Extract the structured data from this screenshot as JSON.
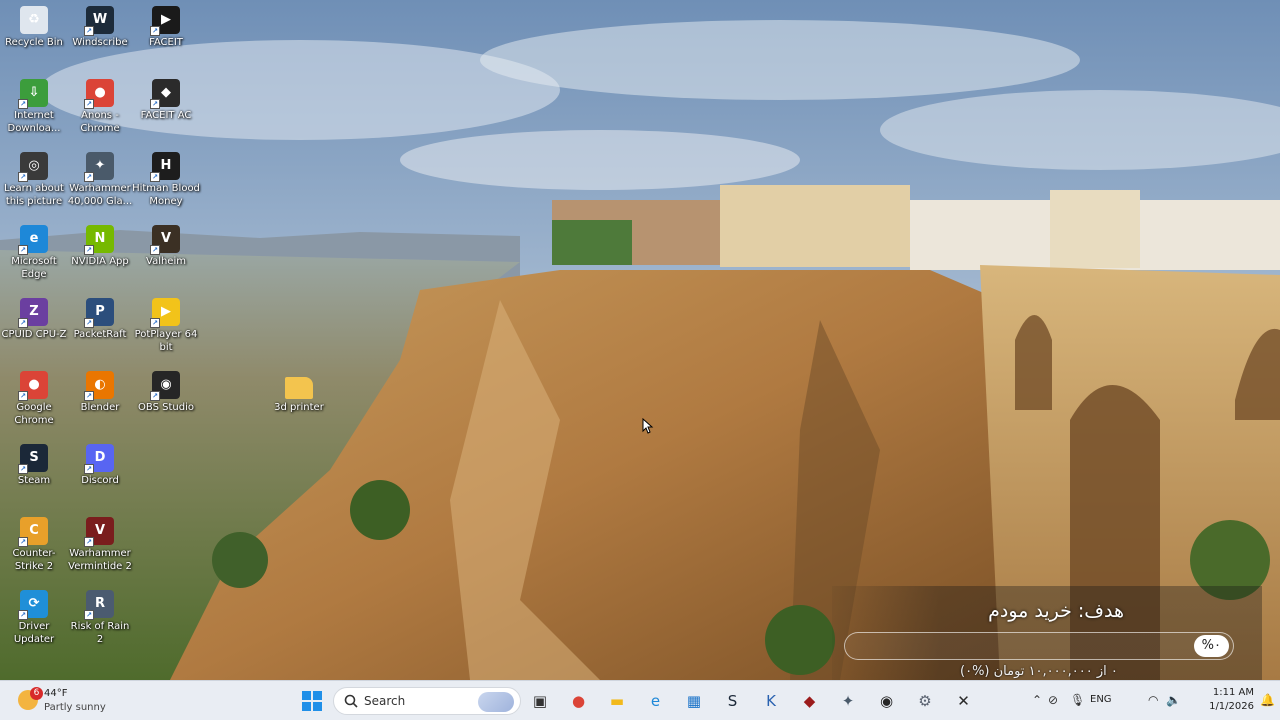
{
  "desktop": {
    "icons": [
      {
        "label": "Recycle Bin",
        "icon": "recycle-bin-icon",
        "color": "#dfe6ee",
        "glyph": "♻"
      },
      {
        "label": "Windscribe",
        "icon": "windscribe-icon",
        "color": "#1d2b3a",
        "glyph": "W"
      },
      {
        "label": "FACEIT",
        "icon": "faceit-icon",
        "color": "#1a1a1a",
        "glyph": "▶"
      },
      {
        "label": "Internet Downloa...",
        "icon": "idm-icon",
        "color": "#3c9d3c",
        "glyph": "⇩"
      },
      {
        "label": "Anons - Chrome",
        "icon": "chrome-icon",
        "color": "#db4437",
        "glyph": "●"
      },
      {
        "label": "FACEIT AC",
        "icon": "faceit-ac-icon",
        "color": "#2b2b2b",
        "glyph": "◆"
      },
      {
        "label": "Learn about this picture",
        "icon": "camera-icon",
        "color": "#3a3a3a",
        "glyph": "◎"
      },
      {
        "label": "Warhammer 40,000 Gla...",
        "icon": "warhammer-icon",
        "color": "#4a5a6a",
        "glyph": "✦"
      },
      {
        "label": "Hitman Blood Money",
        "icon": "hitman-icon",
        "color": "#1d1d1d",
        "glyph": "H"
      },
      {
        "label": "Microsoft Edge",
        "icon": "edge-icon",
        "color": "#1e88d8",
        "glyph": "e"
      },
      {
        "label": "NVIDIA App",
        "icon": "nvidia-icon",
        "color": "#76b900",
        "glyph": "N"
      },
      {
        "label": "Valheim",
        "icon": "valheim-icon",
        "color": "#3b3024",
        "glyph": "V"
      },
      {
        "label": "CPUID CPU-Z",
        "icon": "cpuz-icon",
        "color": "#6b3fa0",
        "glyph": "Z"
      },
      {
        "label": "PacketRaft",
        "icon": "packetraft-icon",
        "color": "#2c4e7c",
        "glyph": "P"
      },
      {
        "label": "PotPlayer 64 bit",
        "icon": "potplayer-icon",
        "color": "#f2c31a",
        "glyph": "▶"
      },
      {
        "label": "Google Chrome",
        "icon": "chrome-icon",
        "color": "#db4437",
        "glyph": "●"
      },
      {
        "label": "Blender",
        "icon": "blender-icon",
        "color": "#ea7600",
        "glyph": "◐"
      },
      {
        "label": "OBS Studio",
        "icon": "obs-icon",
        "color": "#262626",
        "glyph": "◉"
      },
      {
        "label": "3d printer",
        "icon": "folder-icon",
        "color": "#f3c44e",
        "glyph": ""
      },
      {
        "label": "Steam",
        "icon": "steam-icon",
        "color": "#1b2838",
        "glyph": "S"
      },
      {
        "label": "Discord",
        "icon": "discord-icon",
        "color": "#5865f2",
        "glyph": "D"
      },
      {
        "label": "Counter-Strike 2",
        "icon": "cs2-icon",
        "color": "#e8a02a",
        "glyph": "C"
      },
      {
        "label": "Warhammer Vermintide 2",
        "icon": "vermintide-icon",
        "color": "#7a1d1d",
        "glyph": "V"
      },
      {
        "label": "Driver Updater",
        "icon": "driver-updater-icon",
        "color": "#1f8fd8",
        "glyph": "⟳"
      },
      {
        "label": "Risk of Rain 2",
        "icon": "risk-of-rain-icon",
        "color": "#4b5b70",
        "glyph": "R"
      }
    ]
  },
  "goal_widget": {
    "title": "هدف: خرید مودم",
    "percent_label": "%۰",
    "progress_fraction": 0,
    "subtitle": "۰ از ۱۰,۰۰۰,۰۰۰ تومان (%۰)"
  },
  "taskbar": {
    "weather": {
      "temp": "44°F",
      "desc": "Partly sunny",
      "badge": "6"
    },
    "search": {
      "placeholder": "Search"
    },
    "pinned": [
      {
        "name": "task-view-icon",
        "color": "#333333",
        "glyph": "▣"
      },
      {
        "name": "chrome-icon",
        "color": "#db4437",
        "glyph": "●"
      },
      {
        "name": "file-explorer-icon",
        "color": "#f2b91b",
        "glyph": "▬"
      },
      {
        "name": "edge-icon",
        "color": "#1e88d8",
        "glyph": "e"
      },
      {
        "name": "store-icon",
        "color": "#1a73c9",
        "glyph": "▦"
      },
      {
        "name": "steam-icon",
        "color": "#1b2838",
        "glyph": "S"
      },
      {
        "name": "app-k-icon",
        "color": "#2a62b0",
        "glyph": "K"
      },
      {
        "name": "faceit-ac-icon",
        "color": "#9b1b1b",
        "glyph": "◆"
      },
      {
        "name": "warhammer-icon",
        "color": "#4a5a6a",
        "glyph": "✦"
      },
      {
        "name": "obs-icon",
        "color": "#262626",
        "glyph": "◉"
      },
      {
        "name": "settings-icon",
        "color": "#5a6270",
        "glyph": "⚙"
      },
      {
        "name": "xbox-icon",
        "color": "#2a2a2a",
        "glyph": "✕"
      }
    ],
    "tray": {
      "lang": "ENG",
      "time": "1:11 AM",
      "date": "1/1/2026"
    }
  }
}
